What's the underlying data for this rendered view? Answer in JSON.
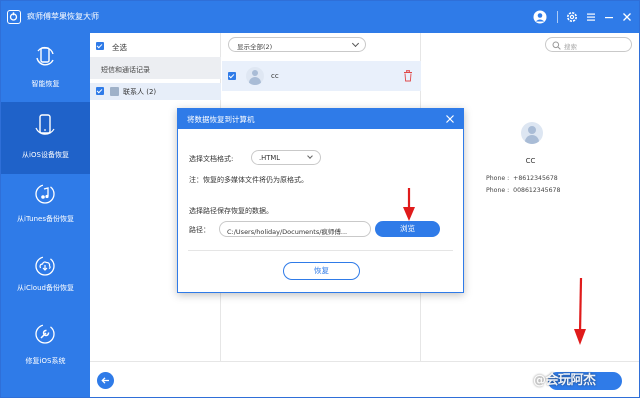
{
  "app": {
    "title": "疯师傅苹果恢复大师"
  },
  "sidebar": {
    "items": [
      {
        "label": "智能恢复",
        "icon": "refresh-phone-icon",
        "active": false
      },
      {
        "label": "从iOS设备恢复",
        "icon": "phone-icon",
        "active": true
      },
      {
        "label": "从iTunes备份恢复",
        "icon": "music-note-icon",
        "active": false
      },
      {
        "label": "从iCloud备份恢复",
        "icon": "cloud-download-icon",
        "active": false
      },
      {
        "label": "修复iOS系统",
        "icon": "wrench-icon",
        "active": false
      }
    ]
  },
  "left_panel": {
    "select_all": "全选",
    "category": "短信和通话记录",
    "sub_item": "联系人 (2)"
  },
  "middle_panel": {
    "filter_value": "显示全部(2)",
    "rows": [
      {
        "name": "cc"
      }
    ]
  },
  "right_panel": {
    "search_placeholder": "搜索",
    "contact": {
      "name": "CC",
      "phones": [
        "Phone :  +8612345678",
        "Phone :  008612345678"
      ]
    }
  },
  "dialog": {
    "title": "将数据恢复到计算机",
    "format_label": "选择文档格式:",
    "format_value": ".HTML",
    "note": "注：恢复的多媒体文件将仍为原格式。",
    "path_title": "选择路径保存恢复的数据。",
    "path_label": "路径：",
    "path_value": "C:/Users/holiday/Documents/疯师傅...",
    "browse_label": "浏览",
    "recover_label": "恢复"
  },
  "watermark": {
    "text": "@会玩阿杰"
  },
  "colors": {
    "primary": "#2f7be8",
    "sidebar_active": "#1f62c9",
    "annotation_arrow": "#e01b1b"
  }
}
